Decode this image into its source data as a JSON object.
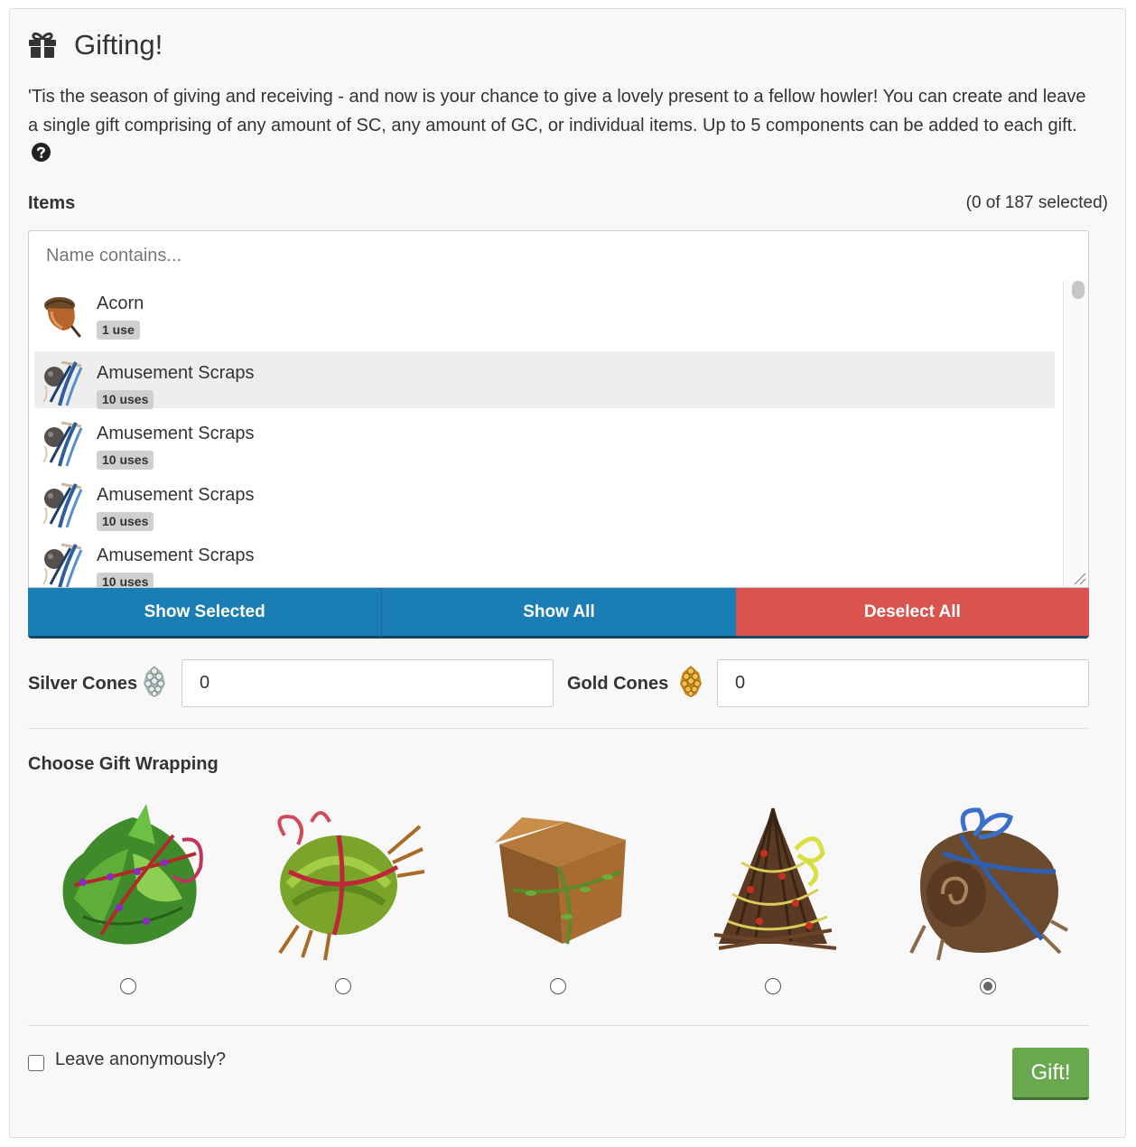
{
  "header": {
    "title": "Gifting!",
    "icon": "gift-icon"
  },
  "intro": {
    "text": "'Tis the season of giving and receiving - and now is your chance to give a lovely present to a fellow howler! You can create and leave a single gift comprising of any amount of SC, any amount of GC, or individual items. Up to 5 components can be added to each gift.",
    "help_icon": "question-circle-icon"
  },
  "items": {
    "label": "Items",
    "count_text": "(0 of 187 selected)",
    "search_placeholder": "Name contains...",
    "list": [
      {
        "name": "Acorn",
        "badge": "1 use",
        "icon": "acorn-icon"
      },
      {
        "name": "Amusement Scraps",
        "badge": "10 uses",
        "icon": "scraps-icon"
      },
      {
        "name": "Amusement Scraps",
        "badge": "10 uses",
        "icon": "scraps-icon"
      },
      {
        "name": "Amusement Scraps",
        "badge": "10 uses",
        "icon": "scraps-icon"
      },
      {
        "name": "Amusement Scraps",
        "badge": "10 uses",
        "icon": "scraps-icon"
      }
    ],
    "buttons": {
      "show_selected": "Show Selected",
      "show_all": "Show All",
      "deselect_all": "Deselect All"
    }
  },
  "cones": {
    "silver_label": "Silver Cones",
    "silver_value": "0",
    "gold_label": "Gold Cones",
    "gold_value": "0"
  },
  "wrapping": {
    "label": "Choose Gift Wrapping",
    "options": [
      {
        "name": "leaf-wrap",
        "selected": false
      },
      {
        "name": "grass-bundle-wrap",
        "selected": false
      },
      {
        "name": "cardboard-box-wrap",
        "selected": false
      },
      {
        "name": "twig-tree-wrap",
        "selected": false
      },
      {
        "name": "bark-roll-wrap",
        "selected": true
      }
    ]
  },
  "footer": {
    "anonymous_label": "Leave anonymously?",
    "gift_button": "Gift!"
  },
  "colors": {
    "primary_blue": "#1a7db3",
    "danger_red": "#d9534f",
    "success_green": "#6aa84f",
    "panel_bg": "#f8f8f8"
  }
}
